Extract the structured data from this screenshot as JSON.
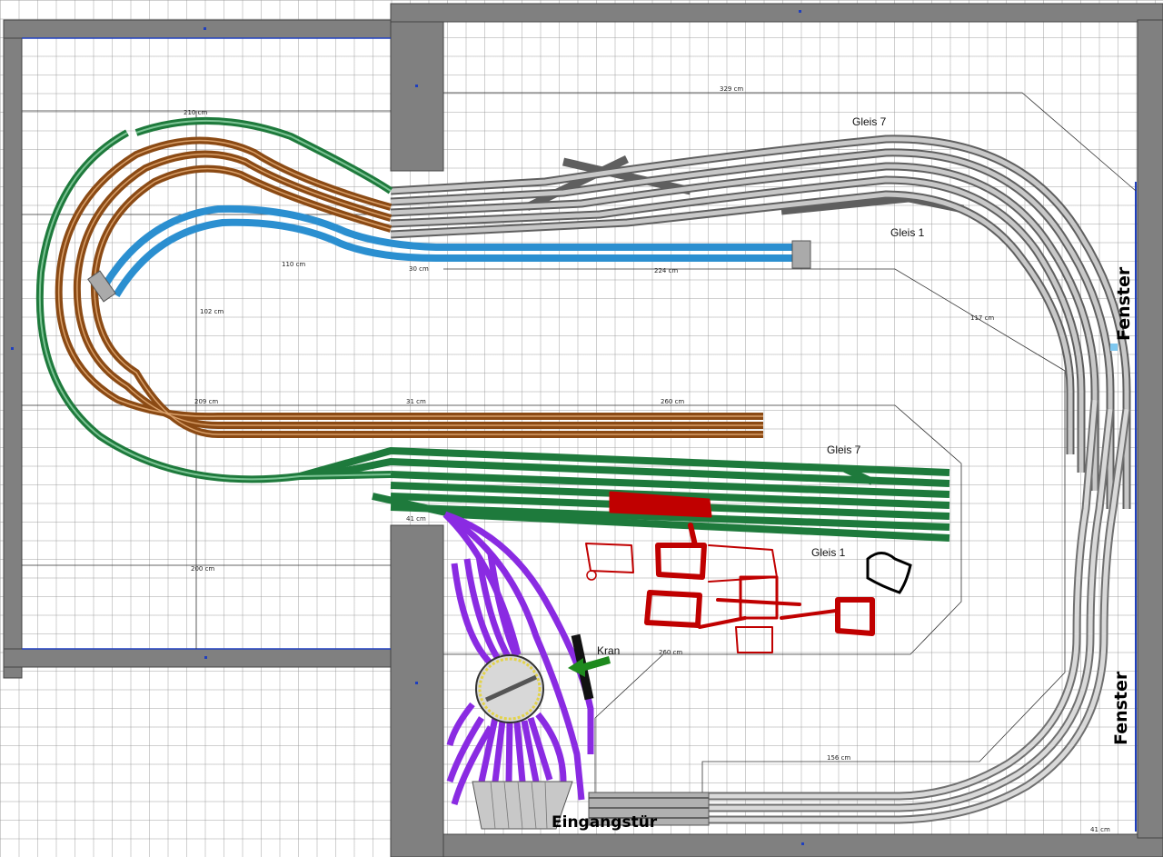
{
  "labels": {
    "gleis7_upper": "Gleis 7",
    "gleis1_upper": "Gleis 1",
    "gleis7_lower": "Gleis 7",
    "gleis1_lower": "Gleis 1",
    "fenster_top": "Fenster",
    "fenster_bottom": "Fenster",
    "kran": "Kran",
    "eingang": "Eingangstür"
  },
  "dimensions": {
    "d329": "329 cm",
    "d110": "110 cm",
    "d30": "30 cm",
    "d224": "224 cm",
    "d209": "209 cm",
    "d31": "31 cm",
    "d260a": "260 cm",
    "d260b": "260 cm",
    "d156": "156 cm",
    "d41a": "41 cm",
    "d41b": "41 cm",
    "d117": "117 cm",
    "d200": "200 cm",
    "d210": "210 cm",
    "d102": "102 cm"
  },
  "colors": {
    "wall": "#808080",
    "track_gray": "#9a9a9a",
    "track_brown": "#8b4a14",
    "track_green": "#1e7a3c",
    "track_blue": "#2b8fd0",
    "track_purple": "#8a2be2",
    "sketch_red": "#c00000"
  }
}
